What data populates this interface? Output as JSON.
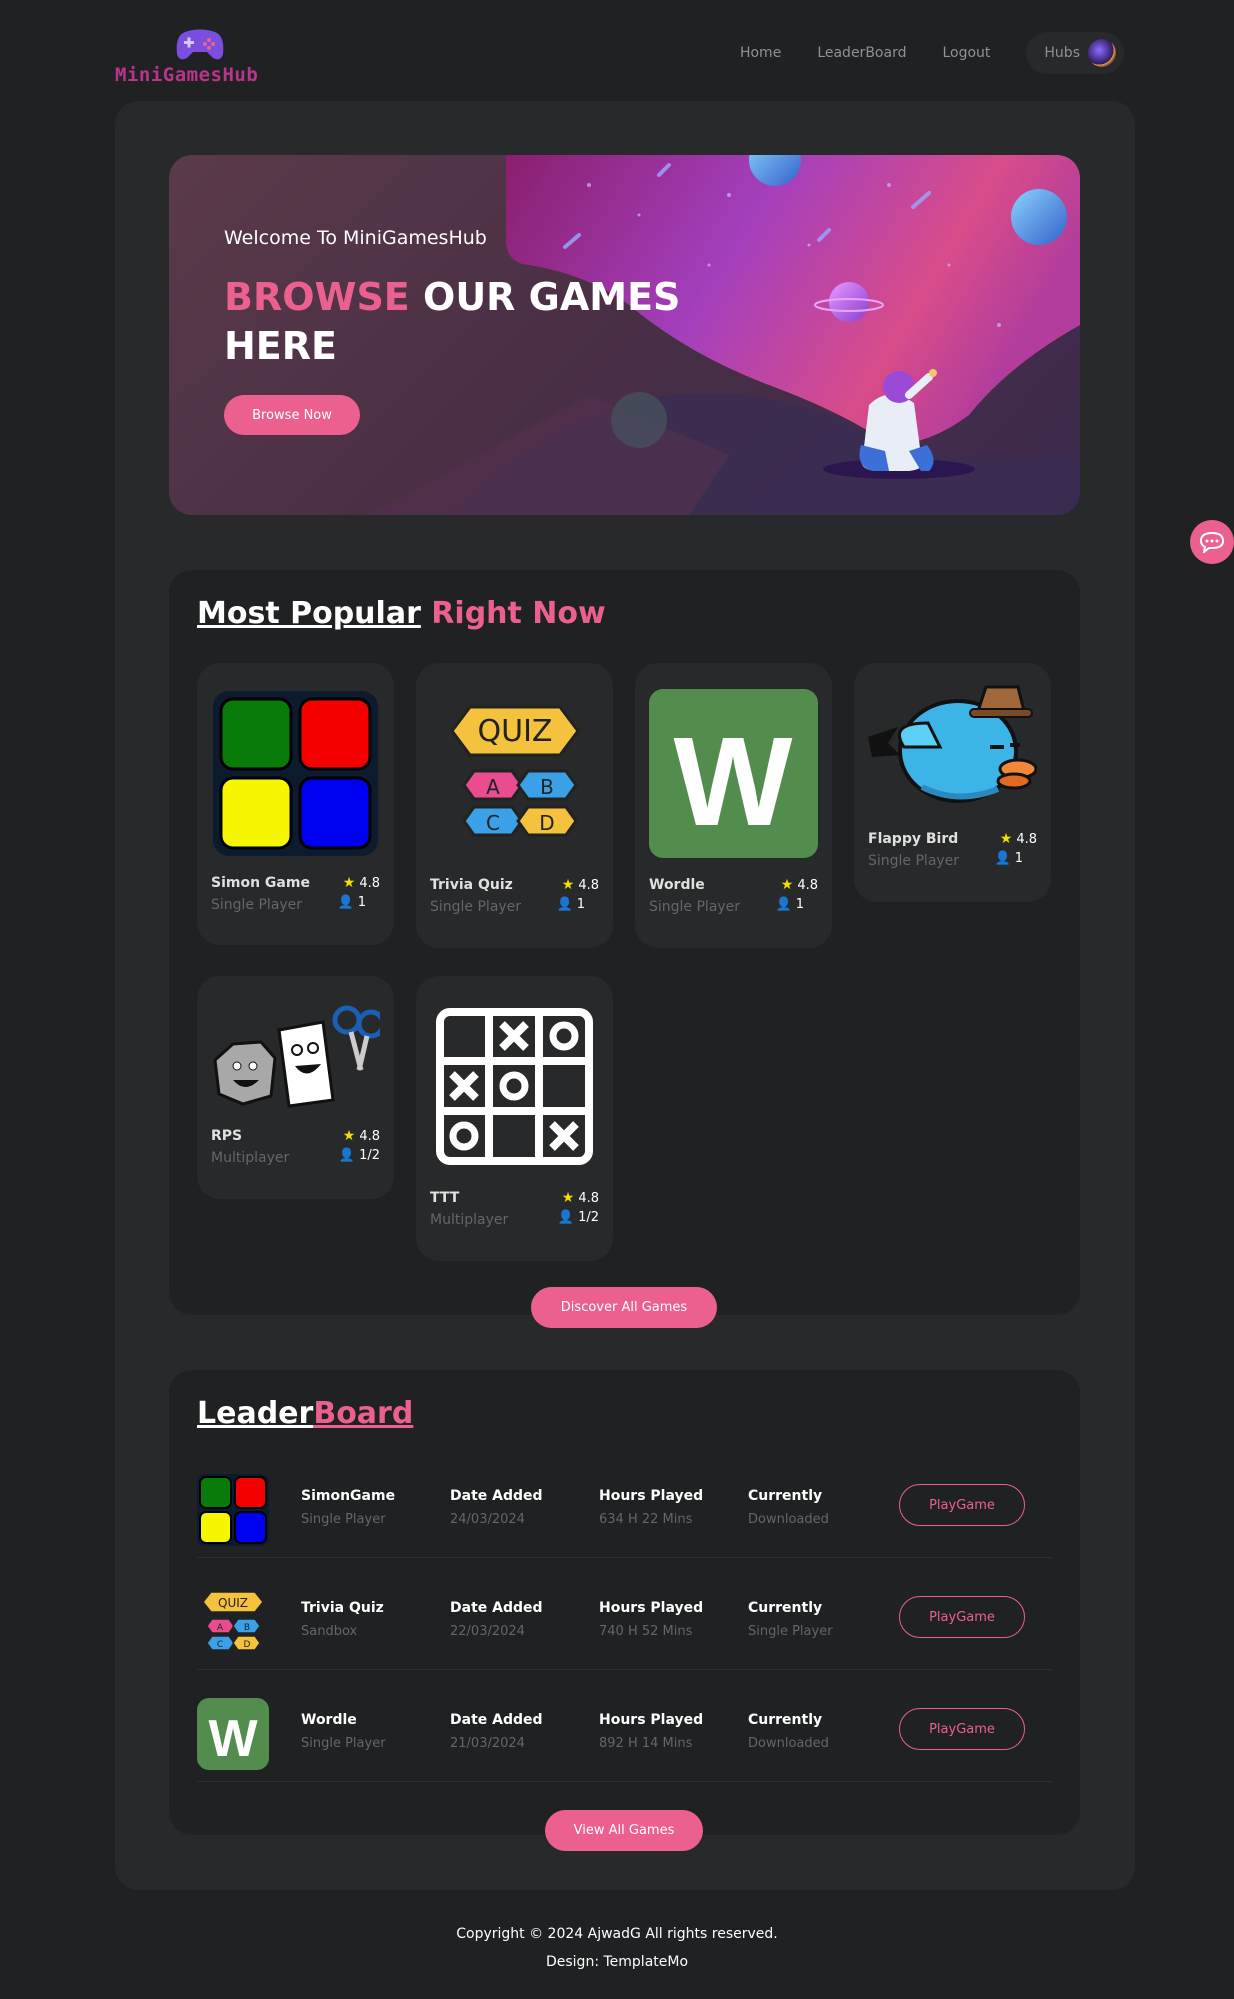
{
  "header": {
    "logo_text": "MiniGamesHub",
    "nav": [
      "Home",
      "LeaderBoard",
      "Logout"
    ],
    "hubs_label": "Hubs"
  },
  "banner": {
    "welcome": "Welcome To MiniGamesHub",
    "headline_pink": "BROWSE",
    "headline_white": " OUR GAMES HERE",
    "button": "Browse Now"
  },
  "popular": {
    "title_white": "Most Popular",
    "title_pink": " Right Now",
    "games": [
      {
        "name": "Simon Game",
        "type": "Single Player",
        "rating": "4.8",
        "players": "1",
        "icon": "simon-icon"
      },
      {
        "name": "Trivia Quiz",
        "type": "Single Player",
        "rating": "4.8",
        "players": "1",
        "icon": "quiz-icon"
      },
      {
        "name": "Wordle",
        "type": "Single Player",
        "rating": "4.8",
        "players": "1",
        "icon": "wordle-icon"
      },
      {
        "name": "Flappy Bird",
        "type": "Single Player",
        "rating": "4.8",
        "players": "1",
        "icon": "flappy-bird-icon"
      },
      {
        "name": "RPS",
        "type": "Multiplayer",
        "rating": "4.8",
        "players": "1/2",
        "icon": "rps-icon"
      },
      {
        "name": "TTT",
        "type": "Multiplayer",
        "rating": "4.8",
        "players": "1/2",
        "icon": "tictactoe-icon"
      }
    ],
    "button": "Discover All Games"
  },
  "leaderboard": {
    "title_white": "Leader",
    "title_pink": "Board",
    "col_date": "Date Added",
    "col_hours": "Hours Played",
    "col_current": "Currently",
    "play_label": "PlayGame",
    "rows": [
      {
        "name": "SimonGame",
        "type": "Single Player",
        "date": "24/03/2024",
        "hours": "634 H 22 Mins",
        "status": "Downloaded"
      },
      {
        "name": "Trivia Quiz",
        "type": "Sandbox",
        "date": "22/03/2024",
        "hours": "740 H 52 Mins",
        "status": "Single Player"
      },
      {
        "name": "Wordle",
        "type": "Single Player",
        "date": "21/03/2024",
        "hours": "892 H 14 Mins",
        "status": "Downloaded"
      }
    ],
    "button": "View All Games"
  },
  "footer": {
    "copyright": "Copyright © 2024 AjwadG All rights reserved.",
    "design": "Design: TemplateMo"
  },
  "colors": {
    "accent": "#ec6090",
    "background": "#1f2122",
    "panel": "#27292a"
  }
}
